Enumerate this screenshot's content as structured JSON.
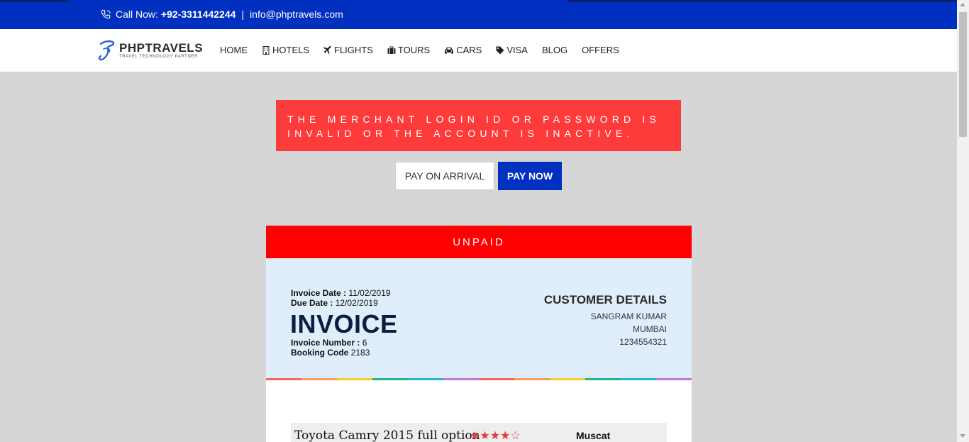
{
  "topbar": {
    "call_label": "Call Now:",
    "phone": "+92-3311442244",
    "separator": "|",
    "email": "info@phptravels.com"
  },
  "logo": {
    "name": "PHPTRAVELS",
    "tagline": "TRAVEL TECHNOLOGY PARTNER"
  },
  "nav": {
    "home": "HOME",
    "hotels": "HOTELS",
    "flights": "FLIGHTS",
    "tours": "TOURS",
    "cars": "CARS",
    "visa": "VISA",
    "blog": "BLOG",
    "offers": "OFFERS"
  },
  "alert": {
    "message": "THE MERCHANT LOGIN ID OR PASSWORD IS INVALID OR THE ACCOUNT IS INACTIVE."
  },
  "payment": {
    "pay_on_arrival": "PAY ON ARRIVAL",
    "pay_now": "PAY NOW"
  },
  "invoice": {
    "status": "UNPAID",
    "date_label": "Invoice Date :",
    "date": "11/02/2019",
    "due_label": "Due Date :",
    "due": "12/02/2019",
    "title": "INVOICE",
    "number_label": "Invoice Number :",
    "number": "6",
    "booking_label": "Booking Code",
    "booking": "2183",
    "customer_title": "CUSTOMER DETAILS",
    "customer_name": "SANGRAM KUMAR",
    "customer_city": "MUMBAI",
    "customer_phone": "1234554321"
  },
  "item": {
    "name": "Toyota Camry 2015 full option",
    "rating": 4,
    "rating_max": 5,
    "stars_filled": "★★★★",
    "stars_empty": "☆",
    "location": "Muscat"
  },
  "colors": {
    "brand_blue": "#0030c0",
    "alert_red": "#fe3b3b",
    "unpaid_red": "#ff0000",
    "invoice_bg": "#e0eefc",
    "stripe": [
      "#f06a6a",
      "#f0a060",
      "#f2d02a",
      "#27b28a",
      "#26b8d0",
      "#c07ad8",
      "#f06a6a",
      "#f0a060",
      "#f2d02a",
      "#27b28a",
      "#26b8d0",
      "#c07ad8"
    ]
  }
}
